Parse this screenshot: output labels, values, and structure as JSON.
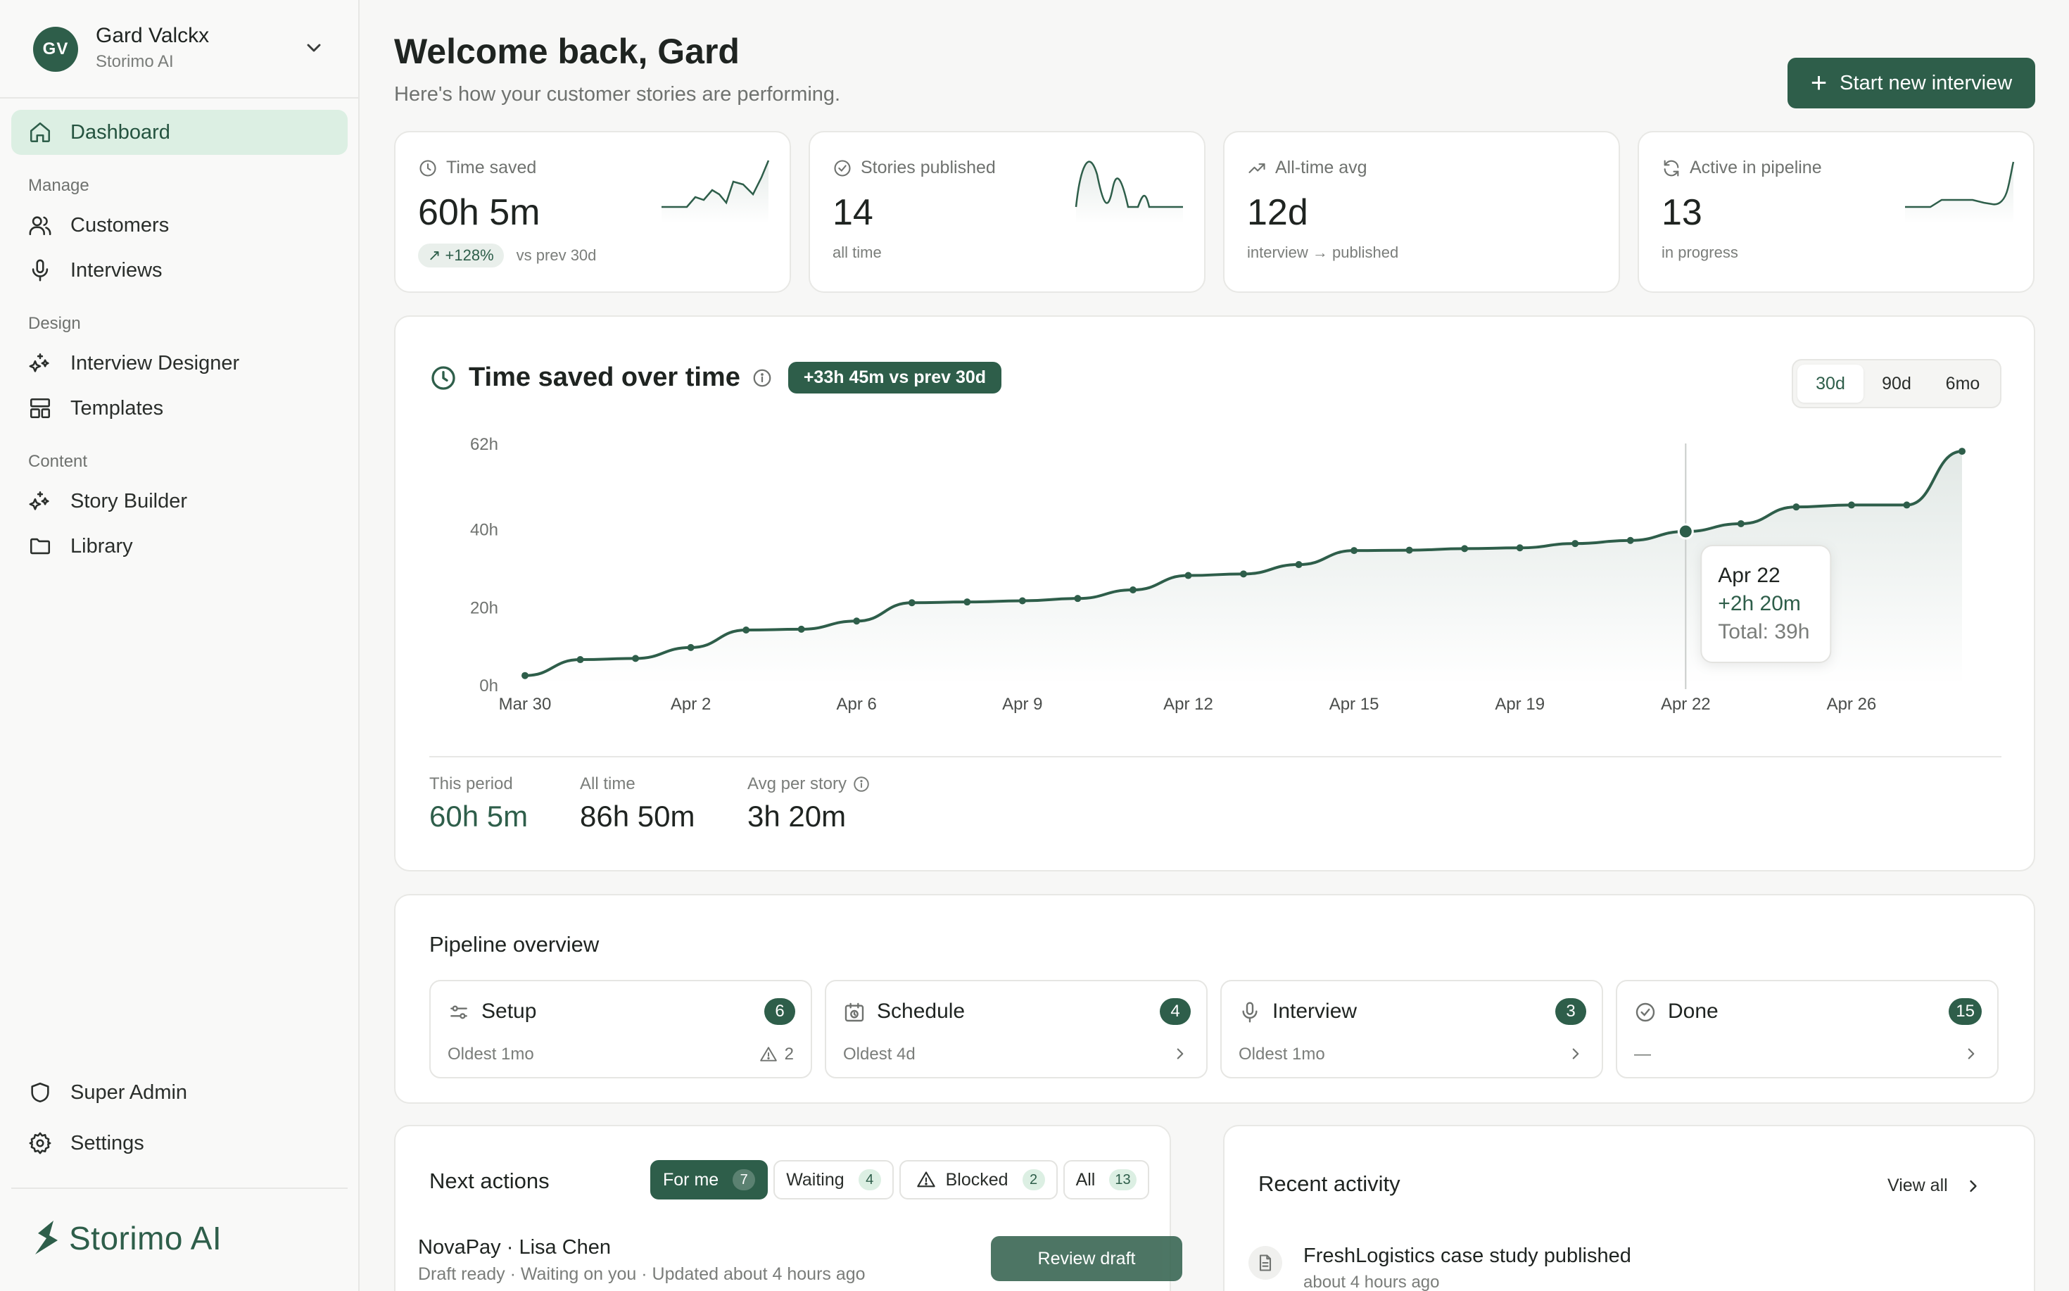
{
  "user": {
    "initials": "GV",
    "name": "Gard Valckx",
    "org": "Storimo AI"
  },
  "nav": {
    "dashboard": "Dashboard",
    "section_manage": "Manage",
    "customers": "Customers",
    "interviews": "Interviews",
    "section_design": "Design",
    "interview_designer": "Interview Designer",
    "templates": "Templates",
    "section_content": "Content",
    "story_builder": "Story Builder",
    "library": "Library",
    "super_admin": "Super Admin",
    "settings": "Settings"
  },
  "brand": {
    "name": "Storimo AI",
    "color": "#2e5e4a"
  },
  "header": {
    "title": "Welcome back, Gard",
    "subtitle": "Here's how your customer stories are performing.",
    "primary_button": "Start new interview"
  },
  "stats": [
    {
      "label": "Time saved",
      "value": "60h 5m",
      "delta": "+128%",
      "sub": "vs prev 30d",
      "icon": "clock-icon"
    },
    {
      "label": "Stories published",
      "value": "14",
      "sub": "all time",
      "icon": "check-circle-icon"
    },
    {
      "label": "All-time avg",
      "value": "12d",
      "sub": "interview → published",
      "icon": "trending-up-icon"
    },
    {
      "label": "Active in pipeline",
      "value": "13",
      "sub": "in progress",
      "icon": "refresh-icon"
    }
  ],
  "chart": {
    "title": "Time saved over time",
    "badge": "+33h 45m vs prev 30d",
    "ranges": [
      "30d",
      "90d",
      "6mo"
    ],
    "active_range": "30d",
    "tooltip": {
      "date": "Apr 22",
      "delta": "+2h 20m",
      "total": "Total: 39h"
    },
    "summary": [
      {
        "label": "This period",
        "value": "60h 5m"
      },
      {
        "label": "All time",
        "value": "86h 50m"
      },
      {
        "label": "Avg per story",
        "value": "3h 20m"
      }
    ]
  },
  "chart_data": {
    "type": "area",
    "title": "Time saved over time",
    "xlabel": "",
    "ylabel": "",
    "y_ticks": [
      "0h",
      "20h",
      "40h",
      "62h"
    ],
    "x_ticks": [
      "Mar 30",
      "Apr 2",
      "Apr 6",
      "Apr 9",
      "Apr 12",
      "Apr 15",
      "Apr 19",
      "Apr 22",
      "Apr 26"
    ],
    "ylim": [
      0,
      62
    ],
    "grid": false,
    "series": [
      {
        "values": [
          2.4,
          6.5,
          6.8,
          9.6,
          14.1,
          14.3,
          16.4,
          21.1,
          21.3,
          21.6,
          22.2,
          24.4,
          28.1,
          28.5,
          30.9,
          34.5,
          34.6,
          35,
          35.2,
          36.3,
          37.1,
          39.4,
          41.4,
          45.7,
          46.2,
          46.2,
          60
        ]
      }
    ]
  },
  "pipeline": {
    "title": "Pipeline overview",
    "stages": [
      {
        "name": "Setup",
        "count": "6",
        "oldest": "Oldest 1mo",
        "warning": "2"
      },
      {
        "name": "Schedule",
        "count": "4",
        "oldest": "Oldest 4d"
      },
      {
        "name": "Interview",
        "count": "3",
        "oldest": "Oldest 1mo"
      },
      {
        "name": "Done",
        "count": "15",
        "oldest": "—"
      }
    ]
  },
  "next_actions": {
    "title": "Next actions",
    "filters": [
      {
        "label": "For me",
        "count": "7"
      },
      {
        "label": "Waiting",
        "count": "4"
      },
      {
        "label": "Blocked",
        "count": "2"
      },
      {
        "label": "All",
        "count": "13"
      }
    ],
    "items": [
      {
        "title": "NovaPay · Lisa Chen",
        "sub": "Draft ready · Waiting on you · Updated about 4 hours ago",
        "action": "Review draft"
      }
    ]
  },
  "activity": {
    "title": "Recent activity",
    "view_all": "View all",
    "items": [
      {
        "title": "FreshLogistics case study published",
        "time": "about 4 hours ago"
      }
    ]
  }
}
